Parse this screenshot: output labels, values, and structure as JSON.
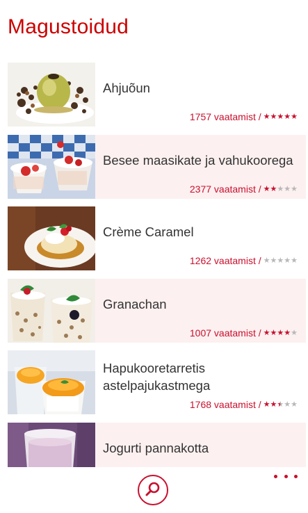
{
  "page": {
    "title": "Magustoidud"
  },
  "recipes": [
    {
      "title": "Ahjuõun",
      "views": "1757 vaatamist /",
      "rating": 5,
      "image": "baked-apple-photo"
    },
    {
      "title": "Besee maasikate ja vahukoorega",
      "views": "2377 vaatamist /",
      "rating": 2,
      "image": "meringue-strawberries-photo"
    },
    {
      "title": "Crème Caramel",
      "views": "1262 vaatamist /",
      "rating": 0,
      "image": "creme-caramel-photo"
    },
    {
      "title": "Granachan",
      "views": "1007 vaatamist /",
      "rating": 4,
      "image": "granachan-photo"
    },
    {
      "title": "Hapukooretarretis astelpajukastmega",
      "views": "1768 vaatamist /",
      "rating": 2.5,
      "image": "sour-cream-jelly-photo"
    },
    {
      "title": "Jogurti pannakotta",
      "views": "",
      "rating": null,
      "image": "yogurt-panna-cotta-photo"
    }
  ],
  "appbar": {
    "search_icon": "search-icon",
    "more_icon": "more-dots-icon"
  },
  "colors": {
    "accent": "#c8102e",
    "title": "#cc0000",
    "alt_row": "#fdf0f0",
    "star_off": "#b8b8b8"
  }
}
